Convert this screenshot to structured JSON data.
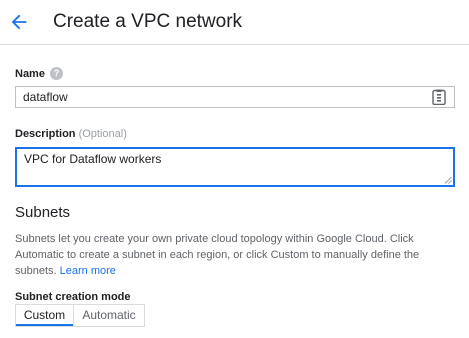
{
  "header": {
    "back_icon": "arrow-back-icon",
    "title": "Create a VPC network"
  },
  "form": {
    "name": {
      "label": "Name",
      "help_icon": "help-icon",
      "help_glyph": "?",
      "value": "dataflow",
      "input_icon": "clipboard-icon"
    },
    "description": {
      "label": "Description",
      "optional_label": "(Optional)",
      "value": "VPC for Dataflow workers"
    }
  },
  "subnets": {
    "title": "Subnets",
    "description": "Subnets let you create your own private cloud topology within Google Cloud. Click Automatic to create a subnet in each region, or click Custom to manually define the subnets.",
    "learn_more": "Learn more",
    "mode_label": "Subnet creation mode",
    "modes": [
      "Custom",
      "Automatic"
    ],
    "selected_mode": "Custom"
  },
  "colors": {
    "accent": "#1a73e8",
    "text": "#202124",
    "secondary_text": "#5f6368",
    "border": "#dadce0"
  }
}
